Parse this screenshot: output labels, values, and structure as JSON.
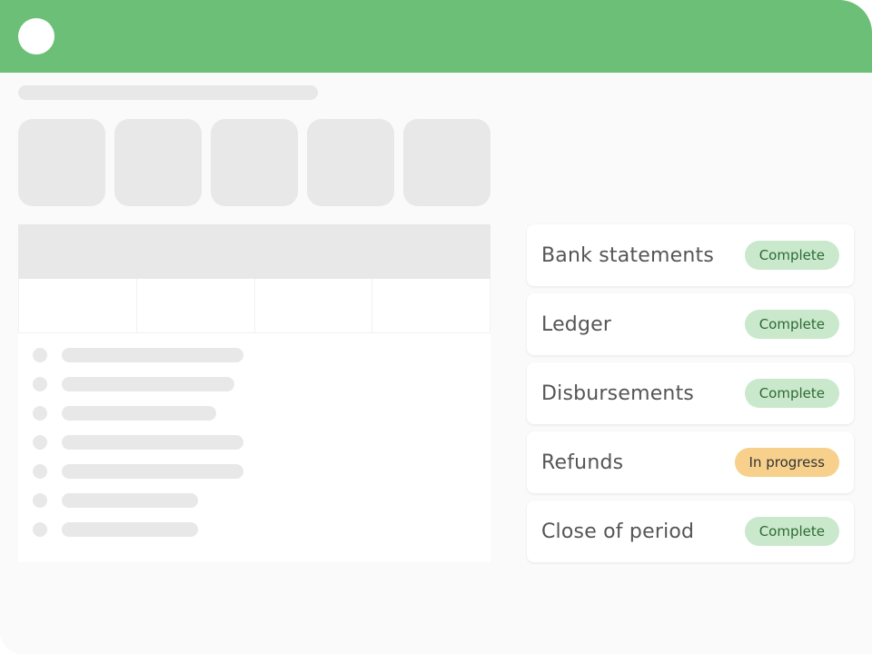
{
  "theme": {
    "header_color": "#6bbf76",
    "skeleton_color": "#e8e8e8",
    "complete_badge_bg": "#c9e8cc",
    "complete_badge_text": "#2e6b34",
    "in_progress_badge_bg": "#f7d08c"
  },
  "header": {
    "logo_icon": "circle-logo"
  },
  "status_cards": [
    {
      "label": "Bank statements",
      "status": "Complete",
      "status_kind": "complete"
    },
    {
      "label": "Ledger",
      "status": "Complete",
      "status_kind": "complete"
    },
    {
      "label": "Disbursements",
      "status": "Complete",
      "status_kind": "complete"
    },
    {
      "label": "Refunds",
      "status": "In progress",
      "status_kind": "progress"
    },
    {
      "label": "Close of period",
      "status": "Complete",
      "status_kind": "complete"
    }
  ]
}
